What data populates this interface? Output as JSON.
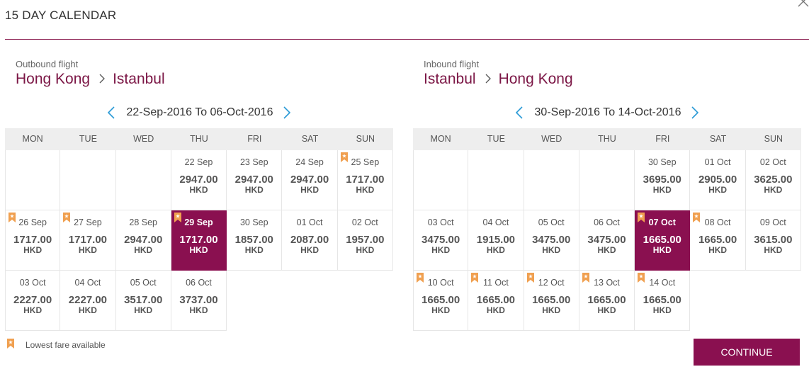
{
  "dialog": {
    "title": "15 DAY CALENDAR",
    "close_icon": "close-icon"
  },
  "colors": {
    "accent": "#8a1050",
    "route": "#7b1645",
    "badge": "#f0a050"
  },
  "outbound": {
    "label": "Outbound flight",
    "origin": "Hong Kong",
    "destination": "Istanbul",
    "range": "22-Sep-2016 To 06-Oct-2016",
    "weekdays": [
      "MON",
      "TUE",
      "WED",
      "THU",
      "FRI",
      "SAT",
      "SUN"
    ],
    "cells": [
      {
        "blank": true
      },
      {
        "blank": true
      },
      {
        "blank": true
      },
      {
        "date": "22 Sep",
        "price": "2947.00",
        "currency": "HKD",
        "lowest": false
      },
      {
        "date": "23 Sep",
        "price": "2947.00",
        "currency": "HKD",
        "lowest": false
      },
      {
        "date": "24 Sep",
        "price": "2947.00",
        "currency": "HKD",
        "lowest": false
      },
      {
        "date": "25 Sep",
        "price": "1717.00",
        "currency": "HKD",
        "lowest": true
      },
      {
        "date": "26 Sep",
        "price": "1717.00",
        "currency": "HKD",
        "lowest": true
      },
      {
        "date": "27 Sep",
        "price": "1717.00",
        "currency": "HKD",
        "lowest": true
      },
      {
        "date": "28 Sep",
        "price": "2947.00",
        "currency": "HKD",
        "lowest": false
      },
      {
        "date": "29 Sep",
        "price": "1717.00",
        "currency": "HKD",
        "lowest": true,
        "selected": true
      },
      {
        "date": "30 Sep",
        "price": "1857.00",
        "currency": "HKD",
        "lowest": false
      },
      {
        "date": "01 Oct",
        "price": "2087.00",
        "currency": "HKD",
        "lowest": false
      },
      {
        "date": "02 Oct",
        "price": "1957.00",
        "currency": "HKD",
        "lowest": false
      },
      {
        "date": "03 Oct",
        "price": "2227.00",
        "currency": "HKD",
        "lowest": false
      },
      {
        "date": "04 Oct",
        "price": "2227.00",
        "currency": "HKD",
        "lowest": false
      },
      {
        "date": "05 Oct",
        "price": "3517.00",
        "currency": "HKD",
        "lowest": false
      },
      {
        "date": "06 Oct",
        "price": "3737.00",
        "currency": "HKD",
        "lowest": false
      },
      {
        "blank": true,
        "tail": true
      },
      {
        "blank": true,
        "tail": true
      },
      {
        "blank": true,
        "tail": true
      }
    ]
  },
  "inbound": {
    "label": "Inbound flight",
    "origin": "Istanbul",
    "destination": "Hong Kong",
    "range": "30-Sep-2016 To 14-Oct-2016",
    "weekdays": [
      "MON",
      "TUE",
      "WED",
      "THU",
      "FRI",
      "SAT",
      "SUN"
    ],
    "cells": [
      {
        "blank": true
      },
      {
        "blank": true
      },
      {
        "blank": true
      },
      {
        "blank": true
      },
      {
        "date": "30 Sep",
        "price": "3695.00",
        "currency": "HKD",
        "lowest": false
      },
      {
        "date": "01 Oct",
        "price": "2905.00",
        "currency": "HKD",
        "lowest": false
      },
      {
        "date": "02 Oct",
        "price": "3625.00",
        "currency": "HKD",
        "lowest": false
      },
      {
        "date": "03 Oct",
        "price": "3475.00",
        "currency": "HKD",
        "lowest": false
      },
      {
        "date": "04 Oct",
        "price": "1915.00",
        "currency": "HKD",
        "lowest": false
      },
      {
        "date": "05 Oct",
        "price": "3475.00",
        "currency": "HKD",
        "lowest": false
      },
      {
        "date": "06 Oct",
        "price": "3475.00",
        "currency": "HKD",
        "lowest": false
      },
      {
        "date": "07 Oct",
        "price": "1665.00",
        "currency": "HKD",
        "lowest": true,
        "selected": true
      },
      {
        "date": "08 Oct",
        "price": "1665.00",
        "currency": "HKD",
        "lowest": true
      },
      {
        "date": "09 Oct",
        "price": "3615.00",
        "currency": "HKD",
        "lowest": false
      },
      {
        "date": "10 Oct",
        "price": "1665.00",
        "currency": "HKD",
        "lowest": true
      },
      {
        "date": "11 Oct",
        "price": "1665.00",
        "currency": "HKD",
        "lowest": true
      },
      {
        "date": "12 Oct",
        "price": "1665.00",
        "currency": "HKD",
        "lowest": true
      },
      {
        "date": "13 Oct",
        "price": "1665.00",
        "currency": "HKD",
        "lowest": true
      },
      {
        "date": "14 Oct",
        "price": "1665.00",
        "currency": "HKD",
        "lowest": true
      },
      {
        "blank": true,
        "tail": true
      },
      {
        "blank": true,
        "tail": true
      }
    ]
  },
  "legend": {
    "text": "Lowest fare available",
    "icon": "lowest-fare-badge-icon"
  },
  "continue_label": "CONTINUE"
}
